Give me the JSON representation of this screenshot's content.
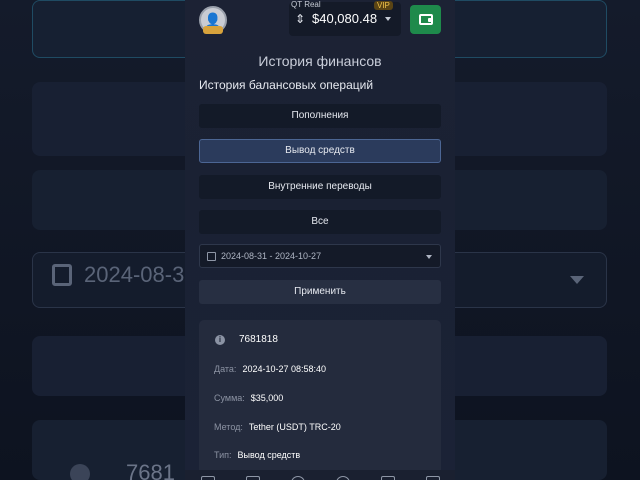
{
  "header": {
    "account_label": "QT Real",
    "vip_badge": "VIP",
    "balance": "$40,080.48"
  },
  "page": {
    "title": "История финансов",
    "subtitle": "История балансовых операций"
  },
  "filters": [
    {
      "label": "Пополнения",
      "active": false
    },
    {
      "label": "Вывод средств",
      "active": true
    },
    {
      "label": "Внутренние переводы",
      "active": false
    },
    {
      "label": "Все",
      "active": false
    }
  ],
  "date_range": "2024-08-31 - 2024-10-27",
  "apply_label": "Применить",
  "transaction": {
    "id": "7681818",
    "rows": [
      {
        "label": "Дата:",
        "value": "2024-10-27 08:58:40"
      },
      {
        "label": "Сумма:",
        "value": "$35,000"
      },
      {
        "label": "Метод:",
        "value": "Tether (USDT) TRC-20"
      },
      {
        "label": "Тип:",
        "value": "Вывод средств"
      }
    ]
  },
  "background": {
    "date_fragment": "2024-08-3",
    "id_fragment": "7681"
  },
  "colors": {
    "accent_green": "#1e8a4b",
    "active_filter": "#2b3b5c",
    "vip": "#f0c24a"
  }
}
